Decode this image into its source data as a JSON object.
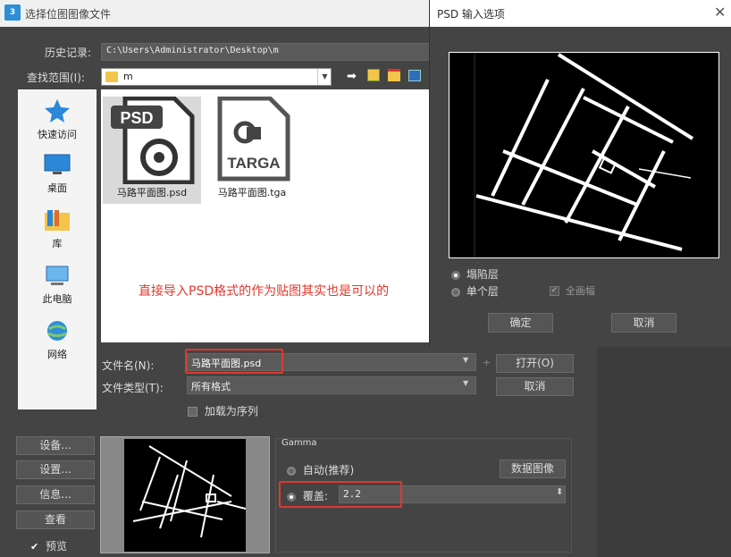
{
  "main": {
    "title": "选择位图图像文件",
    "app_icon": "3",
    "history_label": "历史记录:",
    "history_value": "C:\\Users\\Administrator\\Desktop\\m",
    "lookin_label": "查找范围(I):",
    "lookin_value": "m",
    "places": [
      {
        "label": "快速访问",
        "icon": "star-icon"
      },
      {
        "label": "桌面",
        "icon": "desktop-icon"
      },
      {
        "label": "库",
        "icon": "library-icon"
      },
      {
        "label": "此电脑",
        "icon": "computer-icon"
      },
      {
        "label": "网络",
        "icon": "network-icon"
      }
    ],
    "files": [
      {
        "name": "马路平面图.psd",
        "badge": "PSD"
      },
      {
        "name": "马路平面图.tga",
        "badge": "TARGA"
      }
    ],
    "annotation": "直接导入PSD格式的作为贴图其实也是可以的",
    "filename_label": "文件名(N):",
    "filename_value": "马路平面图.psd",
    "filetype_label": "文件类型(T):",
    "filetype_value": "所有格式",
    "open_button": "打开(O)",
    "cancel_button": "取消",
    "sequence_label": "加载为序列",
    "setup_button_1": "设备...",
    "setup_button_2": "设置...",
    "info_button": "信息...",
    "view_button": "查看",
    "preview_label": "预览",
    "gamma_title": "Gamma",
    "gamma_auto": "自动(推荐)",
    "gamma_override": "覆盖:",
    "gamma_value": "2.2",
    "data_image_button": "数据图像"
  },
  "psd_dialog": {
    "title": "PSD 输入选项",
    "option_collapse": "塌陷层",
    "option_single": "单个层",
    "option_full": "全画幅",
    "ok_button": "确定",
    "cancel_button": "取消"
  },
  "colors": {
    "accent_red": "#e0382e",
    "dark_bg": "#444444"
  }
}
